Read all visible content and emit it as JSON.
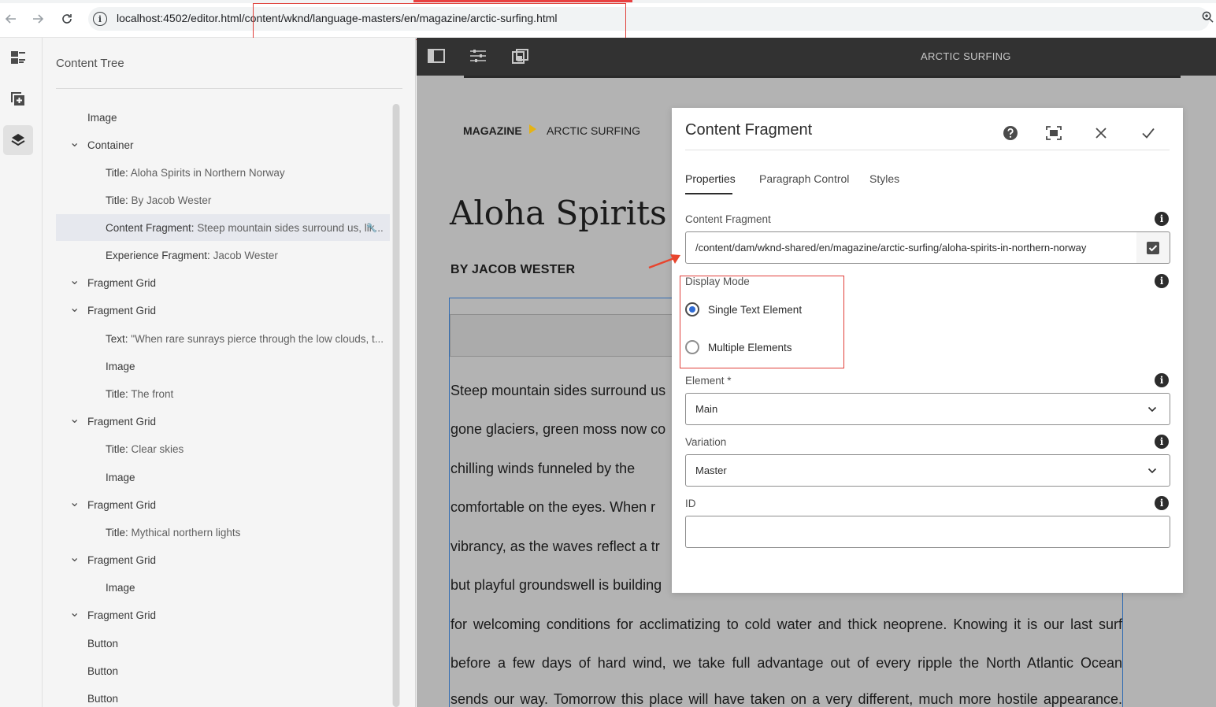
{
  "browser": {
    "url": "localhost:4502/editor.html/content/wknd/language-masters/en/magazine/arctic-surfing.html"
  },
  "rail": {
    "icons": [
      "page-list-icon",
      "add-component-icon",
      "layers-icon"
    ]
  },
  "content_tree": {
    "title": "Content Tree",
    "items": [
      {
        "label": "Image",
        "detail": "",
        "expandable": false
      },
      {
        "label": "Container",
        "detail": "",
        "expandable": true
      },
      {
        "label": "Title:",
        "detail": "Aloha Spirits in Northern Norway",
        "expandable": false
      },
      {
        "label": "Title:",
        "detail": "By Jacob Wester",
        "expandable": false
      },
      {
        "label": "Content Fragment:",
        "detail": "Steep mountain sides surround us, lik...",
        "expandable": false,
        "selected": true
      },
      {
        "label": "Experience Fragment:",
        "detail": "Jacob Wester",
        "expandable": false
      },
      {
        "label": "Fragment Grid",
        "detail": "",
        "expandable": true
      },
      {
        "label": "Fragment Grid",
        "detail": "",
        "expandable": true
      },
      {
        "label": "Text:",
        "detail": "\"When rare sunrays pierce through the low clouds, t...",
        "expandable": false
      },
      {
        "label": "Image",
        "detail": "",
        "expandable": false
      },
      {
        "label": "Title:",
        "detail": "The front",
        "expandable": false
      },
      {
        "label": "Fragment Grid",
        "detail": "",
        "expandable": true
      },
      {
        "label": "Title:",
        "detail": "Clear skies",
        "expandable": false
      },
      {
        "label": "Image",
        "detail": "",
        "expandable": false
      },
      {
        "label": "Fragment Grid",
        "detail": "",
        "expandable": true
      },
      {
        "label": "Title:",
        "detail": "Mythical northern lights",
        "expandable": false
      },
      {
        "label": "Fragment Grid",
        "detail": "",
        "expandable": true
      },
      {
        "label": "Image",
        "detail": "",
        "expandable": false
      },
      {
        "label": "Fragment Grid",
        "detail": "",
        "expandable": true
      },
      {
        "label": "Button",
        "detail": "",
        "expandable": false
      },
      {
        "label": "Button",
        "detail": "",
        "expandable": false
      },
      {
        "label": "Button",
        "detail": "",
        "expandable": false
      }
    ]
  },
  "editor": {
    "page_title": "ARCTIC SURFING",
    "breadcrumb": [
      "MAGAZINE",
      "ARCTIC SURFING"
    ],
    "article_title": "Aloha Spirits in",
    "byline": "BY JACOB WESTER",
    "body_lines": [
      "Steep mountain sides surround us",
      "gone glaciers, green moss now co",
      "chilling winds funneled by the",
      "comfortable on the eyes. When r",
      "vibrancy, as the waves reflect a tr",
      "but playful groundswell is building",
      "for welcoming conditions for acclimatizing to cold water and thick neoprene. Knowing it is our last surf",
      "before a few days of hard wind, we take full advantage out of every ripple the North Atlantic Ocean",
      "sends our way. Tomorrow this place will have taken on a very different, much more hostile appearance."
    ]
  },
  "dialog": {
    "title": "Content Fragment",
    "tabs": [
      "Properties",
      "Paragraph Control",
      "Styles"
    ],
    "content_fragment_label": "Content Fragment",
    "content_fragment_path": "/content/dam/wknd-shared/en/magazine/arctic-surfing/aloha-spirits-in-northern-norway",
    "display_mode_label": "Display Mode",
    "display_mode_options": [
      "Single Text Element",
      "Multiple Elements"
    ],
    "display_mode_selected": "Single Text Element",
    "element_label": "Element *",
    "element_value": "Main",
    "variation_label": "Variation",
    "variation_value": "Master",
    "id_label": "ID",
    "id_value": ""
  },
  "colors": {
    "annotation_red": "#e0403a",
    "selection_blue": "#2f6bb3",
    "radio_blue": "#2f6bd4",
    "breadcrumb_arrow": "#e5b314"
  }
}
